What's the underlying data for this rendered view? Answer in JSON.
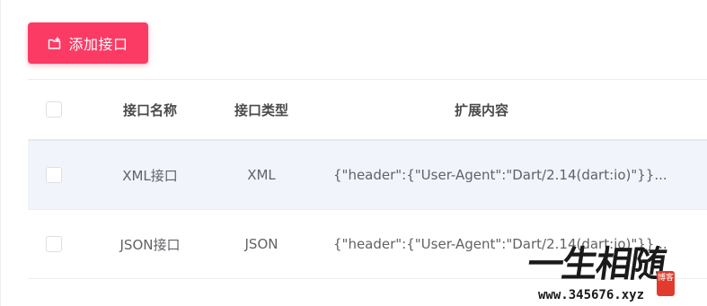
{
  "toolbar": {
    "add_label": "添加接口",
    "add_icon": "add-folder-icon",
    "accent": "#fb3b64"
  },
  "table": {
    "headers": {
      "name": "接口名称",
      "type": "接口类型",
      "ext": "扩展内容"
    },
    "rows": [
      {
        "name": "XML接口",
        "type": "XML",
        "ext": "{\"header\":{\"User-Agent\":\"Dart/2.14(dart:io)\"}}..."
      },
      {
        "name": "JSON接口",
        "type": "JSON",
        "ext": "{\"header\":{\"User-Agent\":\"Dart/2.14(dart:io)\"}}..."
      }
    ]
  },
  "watermark": {
    "logo_text": "一生相随",
    "url": "www.345676.xyz",
    "seal_text": "博客"
  }
}
